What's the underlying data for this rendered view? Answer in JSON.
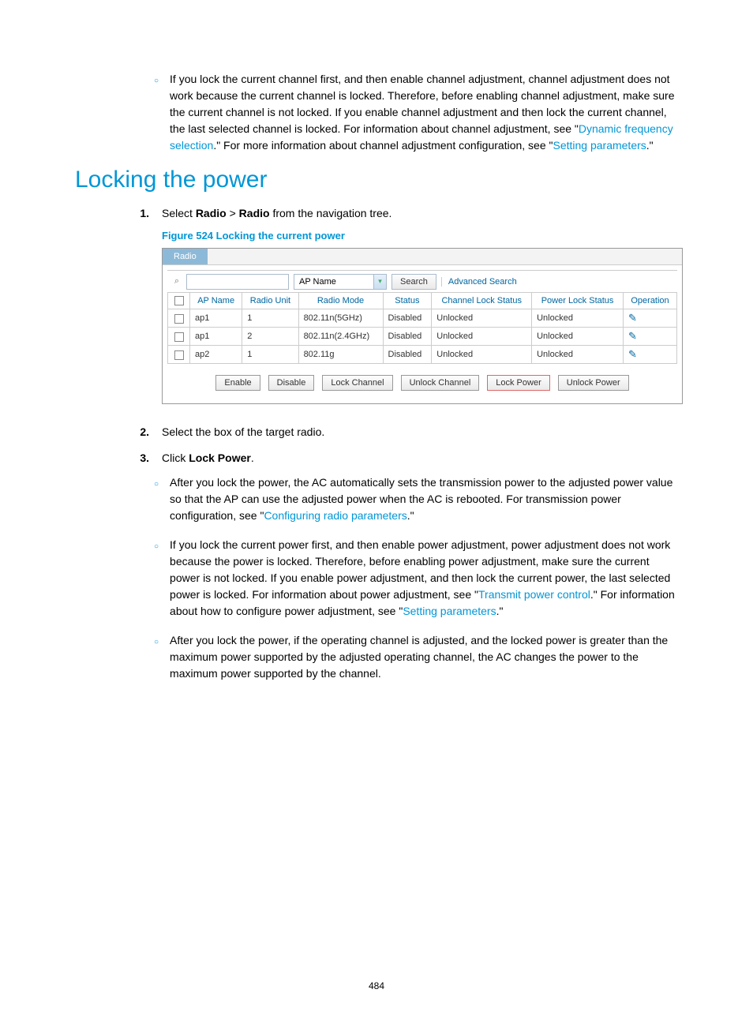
{
  "top_note": {
    "text_before_link1": "If you lock the current channel first, and then enable channel adjustment, channel adjustment does not work because the current channel is locked. Therefore, before enabling channel adjustment, make sure the current channel is not locked. If you enable channel adjustment and then lock the current channel, the last selected channel is locked. For information about channel adjustment, see \"",
    "link1": "Dynamic frequency selection",
    "text_mid": ".\" For more information about channel adjustment configuration, see \"",
    "link2": "Setting parameters",
    "text_after": ".\""
  },
  "heading": "Locking the power",
  "step1": {
    "num": "1.",
    "prefix": "Select ",
    "b1": "Radio",
    "mid": " > ",
    "b2": "Radio",
    "suffix": " from the navigation tree."
  },
  "figcap": "Figure 524 Locking the current power",
  "screenshot": {
    "tab": "Radio",
    "dropdown": "AP Name",
    "search_btn": "Search",
    "adv": "Advanced Search",
    "headers": {
      "apname": "AP Name",
      "unit": "Radio Unit",
      "mode": "Radio Mode",
      "status": "Status",
      "chlock": "Channel Lock Status",
      "pwlock": "Power Lock Status",
      "op": "Operation"
    },
    "rows": [
      {
        "apname": "ap1",
        "unit": "1",
        "mode": "802.11n(5GHz)",
        "status": "Disabled",
        "chlock": "Unlocked",
        "pwlock": "Unlocked"
      },
      {
        "apname": "ap1",
        "unit": "2",
        "mode": "802.11n(2.4GHz)",
        "status": "Disabled",
        "chlock": "Unlocked",
        "pwlock": "Unlocked"
      },
      {
        "apname": "ap2",
        "unit": "1",
        "mode": "802.11g",
        "status": "Disabled",
        "chlock": "Unlocked",
        "pwlock": "Unlocked"
      }
    ],
    "btns": {
      "enable": "Enable",
      "disable": "Disable",
      "lockch": "Lock Channel",
      "unlockch": "Unlock Channel",
      "lockpw": "Lock Power",
      "unlockpw": "Unlock Power"
    }
  },
  "step2": {
    "num": "2.",
    "text": "Select the box of the target radio."
  },
  "step3": {
    "num": "3.",
    "prefix": "Click ",
    "b": "Lock Power",
    "suffix": "."
  },
  "sub1": {
    "before": "After you lock the power, the AC automatically sets the transmission power to the adjusted power value so that the AP can use the adjusted power when the AC is rebooted. For transmission power configuration, see \"",
    "link": "Configuring radio parameters",
    "after": ".\""
  },
  "sub2": {
    "t1": "If you lock the current power first, and then enable power adjustment, power adjustment does not work because the power is locked. Therefore, before enabling power adjustment, make sure the current power is not locked. If you enable power adjustment, and then lock the current power, the last selected power is locked. For information about power adjustment, see \"",
    "link1": "Transmit power control",
    "t2": ".\" For information about how to configure power adjustment, see \"",
    "link2": "Setting parameters",
    "t3": ".\""
  },
  "sub3": "After you lock the power, if the operating channel is adjusted, and the locked power is greater than the maximum power supported by the adjusted operating channel, the AC changes the power to the maximum power supported by the channel.",
  "pagenum": "484"
}
